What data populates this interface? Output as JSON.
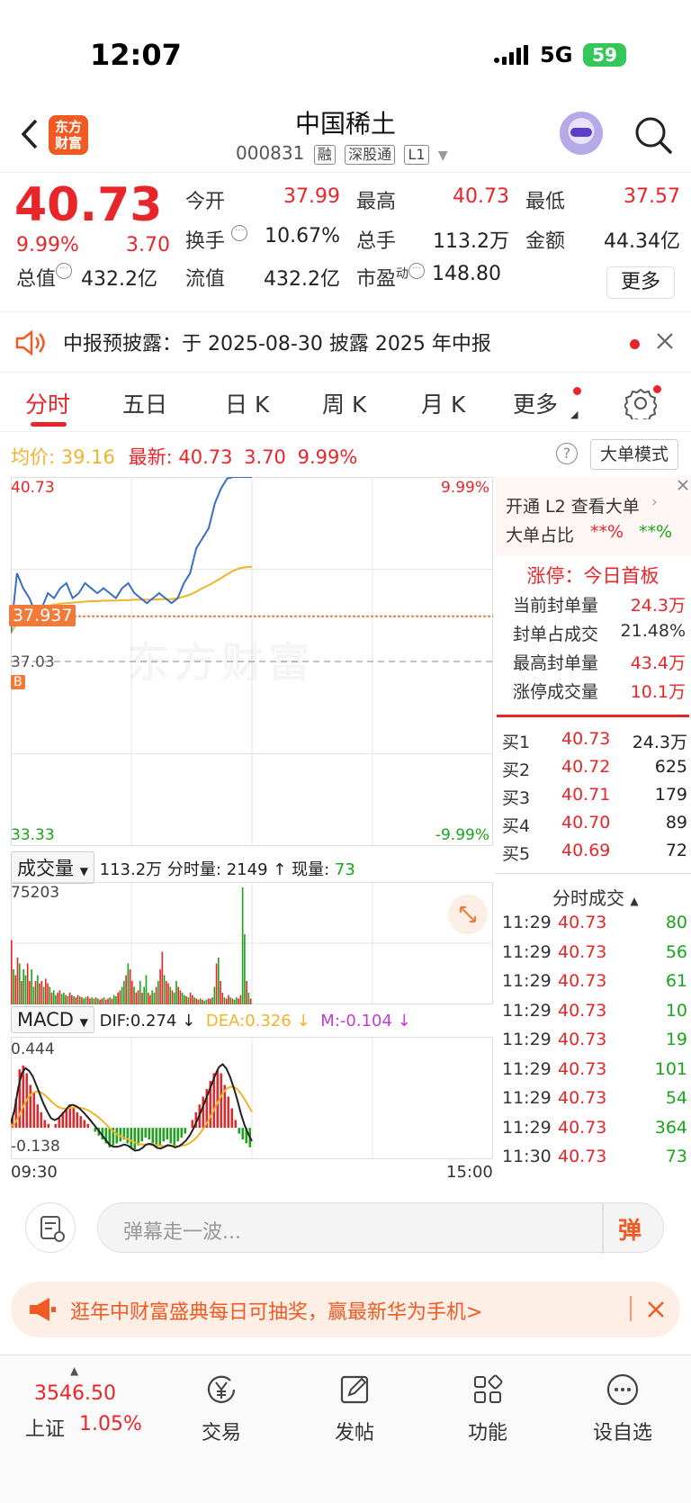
{
  "status": {
    "time": "12:07",
    "network": "5G",
    "battery": "59"
  },
  "nav": {
    "logo": "东方财富",
    "title": "中国稀土",
    "code": "000831",
    "tags": [
      "融",
      "深股通",
      "L1"
    ]
  },
  "quote": {
    "price": "40.73",
    "change_pct": "9.99%",
    "change": "3.70",
    "open_label": "今开",
    "open": "37.99",
    "high_label": "最高",
    "high": "40.73",
    "low_label": "最低",
    "low": "37.57",
    "turnover_label": "换手",
    "turnover": "10.67%",
    "volume_label": "总手",
    "volume": "113.2万",
    "amount_label": "金额",
    "amount": "44.34亿",
    "mktcap_label": "总值",
    "mktcap": "432.2亿",
    "float_label": "流值",
    "float": "432.2亿",
    "pe_label": "市盈",
    "pe_sup": "动",
    "pe": "148.80",
    "more": "更多"
  },
  "notice": {
    "text": "中报预披露：于 2025-08-30 披露 2025 年中报"
  },
  "tabs": [
    "分时",
    "五日",
    "日 K",
    "周 K",
    "月 K",
    "更多"
  ],
  "info": {
    "avg_label": "均价:",
    "avg": "39.16",
    "latest_label": "最新:",
    "latest": "40.73",
    "change": "3.70",
    "pct": "9.99%",
    "mode": "大单模式"
  },
  "chart_data": [
    {
      "type": "line",
      "title": "分时",
      "y_top": "40.73",
      "y_bottom": "33.33",
      "pct_top": "9.99%",
      "pct_bottom": "-9.99%",
      "prev_close": "37.03",
      "cursor_price": "37.937",
      "marker": "B",
      "x_start": "09:30",
      "x_end": "15:00",
      "series": [
        {
          "name": "最新",
          "color": "#3a6fc4",
          "values": [
            37.6,
            38.8,
            38.5,
            38.3,
            38.0,
            38.1,
            38.4,
            38.3,
            38.5,
            38.6,
            38.3,
            38.4,
            38.6,
            38.5,
            38.4,
            38.5,
            38.4,
            38.3,
            38.5,
            38.6,
            38.4,
            38.3,
            38.2,
            38.3,
            38.4,
            38.3,
            38.2,
            38.3,
            38.6,
            38.8,
            39.3,
            39.5,
            39.7,
            40.2,
            40.5,
            40.7,
            40.73,
            40.73,
            40.73,
            40.73
          ]
        },
        {
          "name": "均价",
          "color": "#f0b42a",
          "values": [
            37.6,
            37.8,
            37.95,
            38.05,
            38.1,
            38.12,
            38.15,
            38.17,
            38.19,
            38.2,
            38.21,
            38.22,
            38.23,
            38.24,
            38.24,
            38.25,
            38.25,
            38.25,
            38.26,
            38.26,
            38.27,
            38.27,
            38.27,
            38.27,
            38.28,
            38.28,
            38.28,
            38.3,
            38.33,
            38.37,
            38.43,
            38.5,
            38.56,
            38.63,
            38.7,
            38.78,
            38.85,
            38.9,
            38.92,
            38.93
          ]
        }
      ]
    },
    {
      "type": "bar",
      "title": "成交量",
      "summary": "113.2万",
      "minute_label": "分时量:",
      "minute_vol": "2149",
      "now_label": "现量:",
      "now_vol": "73",
      "ymax": "75203",
      "values": [
        0.55,
        0.3,
        0.25,
        0.4,
        0.35,
        0.2,
        0.3,
        0.25,
        0.35,
        0.2,
        0.3,
        0.15,
        0.2,
        0.25,
        0.18,
        0.2,
        0.15,
        0.22,
        0.18,
        0.15,
        0.1,
        0.12,
        0.08,
        0.1,
        0.12,
        0.09,
        0.1,
        0.08,
        0.07,
        0.1,
        0.08,
        0.07,
        0.06,
        0.08,
        0.07,
        0.06,
        0.05,
        0.06,
        0.07,
        0.05,
        0.06,
        0.05,
        0.06,
        0.05,
        0.04,
        0.05,
        0.06,
        0.04,
        0.05,
        0.06,
        0.05,
        0.08,
        0.07,
        0.1,
        0.12,
        0.15,
        0.2,
        0.25,
        0.35,
        0.3,
        0.2,
        0.15,
        0.1,
        0.12,
        0.2,
        0.1,
        0.15,
        0.25,
        0.1,
        0.08,
        0.12,
        0.1,
        0.15,
        0.2,
        0.3,
        0.45,
        0.25,
        0.2,
        0.18,
        0.15,
        0.12,
        0.1,
        0.2,
        0.15,
        0.12,
        0.1,
        0.08,
        0.07,
        0.06,
        0.1,
        0.08,
        0.06,
        0.05,
        0.04,
        0.05,
        0.04,
        0.03,
        0.04,
        0.05,
        0.05,
        0.06,
        0.15,
        0.35,
        0.4,
        0.2,
        0.1,
        0.06,
        0.05,
        0.08,
        0.06,
        0.05,
        0.04,
        0.06,
        0.05,
        0.08,
        1.0,
        0.6,
        0.2,
        0.1,
        0.05
      ]
    },
    {
      "type": "bar",
      "title": "MACD",
      "dif_label": "DIF:",
      "dif": "0.274",
      "dea_label": "DEA:",
      "dea": "0.326",
      "m_label": "M:",
      "m": "-0.104",
      "ymax": "0.444",
      "ymin": "-0.138",
      "values": [
        0.05,
        0.15,
        0.3,
        0.32,
        0.28,
        0.22,
        0.18,
        0.12,
        0.08,
        0.04,
        0.02,
        0.0,
        0.02,
        0.05,
        0.08,
        0.1,
        0.12,
        0.1,
        0.08,
        0.06,
        0.04,
        0.02,
        0.0,
        -0.02,
        -0.04,
        -0.06,
        -0.08,
        -0.1,
        -0.09,
        -0.08,
        -0.07,
        -0.06,
        -0.08,
        -0.1,
        -0.11,
        -0.09,
        -0.07,
        -0.05,
        -0.06,
        -0.08,
        -0.1,
        -0.09,
        -0.07,
        -0.06,
        -0.08,
        -0.09,
        -0.07,
        -0.05,
        -0.03,
        0.0,
        0.04,
        0.08,
        0.12,
        0.16,
        0.2,
        0.24,
        0.28,
        0.3,
        0.28,
        0.22,
        0.16,
        0.1,
        0.04,
        -0.03,
        -0.06,
        -0.08,
        -0.1
      ]
    }
  ],
  "panel": {
    "l2": "开通 L2 查看大单",
    "big_ratio_label": "大单占比",
    "big_in": "**%",
    "big_out": "**%",
    "limit_title": "涨停：今日首板",
    "rows": [
      {
        "label": "当前封单量",
        "value": "24.3万"
      },
      {
        "label": "封单占成交",
        "value": "21.48%"
      },
      {
        "label": "最高封单量",
        "value": "43.4万"
      },
      {
        "label": "涨停成交量",
        "value": "10.1万"
      }
    ],
    "book": [
      {
        "label": "买1",
        "price": "40.73",
        "vol": "24.3万"
      },
      {
        "label": "买2",
        "price": "40.72",
        "vol": "625"
      },
      {
        "label": "买3",
        "price": "40.71",
        "vol": "179"
      },
      {
        "label": "买4",
        "price": "40.70",
        "vol": "89"
      },
      {
        "label": "买5",
        "price": "40.69",
        "vol": "72"
      }
    ],
    "trades_title": "分时成交",
    "trades": [
      {
        "time": "11:29",
        "price": "40.73",
        "vol": "80"
      },
      {
        "time": "11:29",
        "price": "40.73",
        "vol": "56"
      },
      {
        "time": "11:29",
        "price": "40.73",
        "vol": "61"
      },
      {
        "time": "11:29",
        "price": "40.73",
        "vol": "10"
      },
      {
        "time": "11:29",
        "price": "40.73",
        "vol": "19"
      },
      {
        "time": "11:29",
        "price": "40.73",
        "vol": "101"
      },
      {
        "time": "11:29",
        "price": "40.73",
        "vol": "54"
      },
      {
        "time": "11:29",
        "price": "40.73",
        "vol": "364"
      },
      {
        "time": "11:30",
        "price": "40.73",
        "vol": "73"
      }
    ]
  },
  "comment": {
    "placeholder": "弹幕走一波...",
    "danmu": "弹"
  },
  "banner": {
    "text": "逛年中财富盛典每日可抽奖，赢最新华为手机>"
  },
  "watermark": "东方财富",
  "tabbar": {
    "index_value": "3546.50",
    "index_name": "上证",
    "index_pct": "1.05%",
    "items": [
      "交易",
      "发帖",
      "功能",
      "设自选"
    ]
  }
}
